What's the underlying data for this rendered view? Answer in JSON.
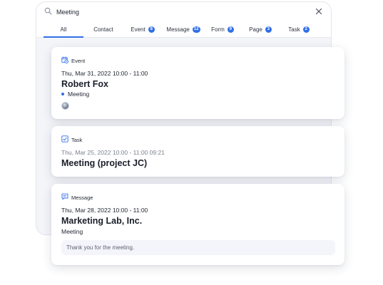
{
  "search": {
    "value": "Meeting",
    "placeholder": ""
  },
  "tabs": [
    {
      "label": "All",
      "count": ""
    },
    {
      "label": "Contact",
      "count": ""
    },
    {
      "label": "Event",
      "count": "8"
    },
    {
      "label": "Message",
      "count": "12"
    },
    {
      "label": "Form",
      "count": "9"
    },
    {
      "label": "Page",
      "count": "3"
    },
    {
      "label": "Task",
      "count": "2"
    }
  ],
  "accent_color": "#2f6fe8",
  "results": {
    "event": {
      "type_label": "Event",
      "icon": "calendar-clock-icon",
      "date": "Thu, Mar 31, 2022 10:00 - 11:00",
      "title": "Robert Fox",
      "status": "Meeting"
    },
    "task": {
      "type_label": "Task",
      "icon": "checkbox-checked-icon",
      "date": "Thu, Mar 25, 2022 10:00 - 11:00 09:21",
      "title": "Meeting (project JC)"
    },
    "message": {
      "type_label": "Message",
      "icon": "chat-bubble-icon",
      "date": "Thu, Mar 28, 2022 10:00 - 11:00",
      "title": "Marketing Lab, Inc.",
      "subtitle": "Meeting",
      "preview": "Thank you for the meeting."
    }
  }
}
